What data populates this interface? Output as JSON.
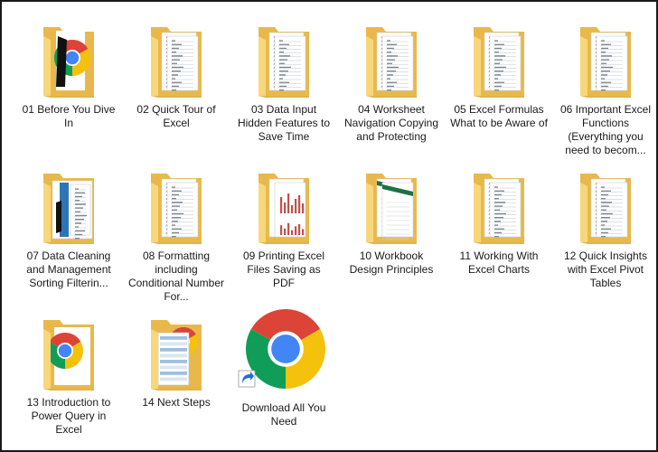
{
  "items": [
    {
      "label": "01 Before You Dive In",
      "preview": "chrome-and-photo"
    },
    {
      "label": "02 Quick Tour of Excel",
      "preview": "spreadsheet"
    },
    {
      "label": "03 Data Input Hidden Features to Save Time",
      "preview": "spreadsheet"
    },
    {
      "label": "04 Worksheet Navigation Copying and Protecting",
      "preview": "spreadsheet"
    },
    {
      "label": "05 Excel Formulas  What to be Aware of",
      "preview": "spreadsheet"
    },
    {
      "label": "06 Important Excel Functions (Everything you need to becom...",
      "preview": "spreadsheet"
    },
    {
      "label": "07 Data Cleaning and Management Sorting Filterin...",
      "preview": "photo"
    },
    {
      "label": "08 Formatting including Conditional Number For...",
      "preview": "spreadsheet"
    },
    {
      "label": "09 Printing Excel Files  Saving as PDF",
      "preview": "bar-chart"
    },
    {
      "label": "10 Workbook Design Principles",
      "preview": "green-sheet"
    },
    {
      "label": "11 Working With Excel Charts",
      "preview": "spreadsheet"
    },
    {
      "label": "12 Quick Insights with Excel Pivot Tables",
      "preview": "spreadsheet"
    },
    {
      "label": "13 Introduction to Power Query in Excel",
      "preview": "chrome"
    },
    {
      "label": "14 Next Steps",
      "preview": "chrome-and-table"
    },
    {
      "label": "Download All You Need",
      "preview": "shortcut"
    }
  ],
  "colors": {
    "folder_back": "#e8b94a",
    "folder_front": "#f8d77a",
    "chrome_red": "#db4437",
    "chrome_yellow": "#f4c20d",
    "chrome_green": "#0f9d58",
    "chrome_blue": "#4285f4"
  }
}
